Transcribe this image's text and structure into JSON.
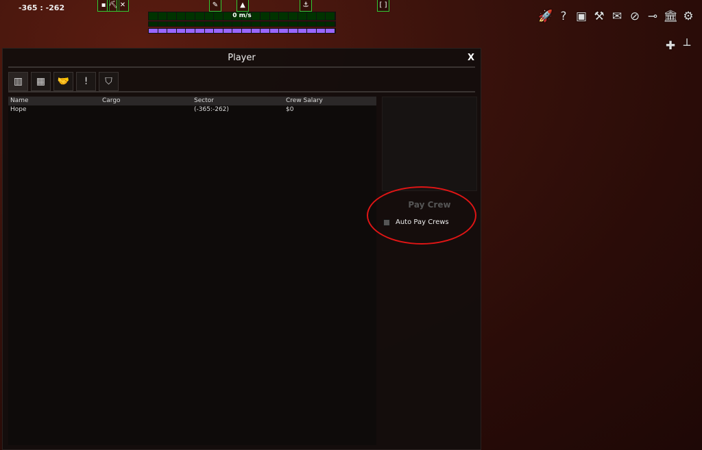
{
  "hud": {
    "coords": "-365 : -262",
    "speed": "0 m/s",
    "buttons": [
      {
        "icon": "dot-icon",
        "glyph": "▪"
      },
      {
        "icon": "pickaxe-icon",
        "glyph": "⛏"
      },
      {
        "icon": "tools-icon",
        "glyph": "✕"
      },
      {
        "icon": "pencil-icon",
        "glyph": "✎"
      },
      {
        "icon": "arrow-up-icon",
        "glyph": "▲"
      },
      {
        "icon": "anchor-icon",
        "glyph": "⚓"
      },
      {
        "icon": "frame-icon",
        "glyph": "[ ]"
      }
    ],
    "speed_bar_color": "#003300",
    "power_bar_color": "#9966ff"
  },
  "toolbar": {
    "icons": [
      {
        "name": "rocket-icon",
        "glyph": "🚀"
      },
      {
        "name": "help-icon",
        "glyph": "?"
      },
      {
        "name": "catalog-icon",
        "glyph": "▣"
      },
      {
        "name": "robot-arm-icon",
        "glyph": "⚒"
      },
      {
        "name": "mail-icon",
        "glyph": "✉"
      },
      {
        "name": "navigation-icon",
        "glyph": "⊘"
      },
      {
        "name": "weapon-icon",
        "glyph": "⊸"
      },
      {
        "name": "faction-icon",
        "glyph": "🏛"
      },
      {
        "name": "puzzle-gear-icon",
        "glyph": "⚙"
      }
    ],
    "icons2": [
      {
        "name": "puzzle-icon",
        "glyph": "✚"
      },
      {
        "name": "structure-icon",
        "glyph": "┴"
      }
    ]
  },
  "window": {
    "title": "Player",
    "close": "X",
    "tabs": [
      {
        "name": "stats-tab",
        "glyph": "▥"
      },
      {
        "name": "grid-tab",
        "glyph": "▦"
      },
      {
        "name": "diplomacy-tab",
        "glyph": "🤝"
      },
      {
        "name": "alerts-tab",
        "glyph": "!"
      },
      {
        "name": "banner-tab",
        "glyph": "⛉"
      }
    ],
    "columns": [
      "Name",
      "Cargo",
      "Sector",
      "Crew Salary"
    ],
    "rows": [
      [
        "Hope",
        "",
        "(-365:-262)",
        "$0"
      ]
    ],
    "pay_crew": "Pay Crew",
    "auto_pay": "Auto Pay Crews",
    "auto_pay_checked": false,
    "highlight_color": "#e01515"
  }
}
